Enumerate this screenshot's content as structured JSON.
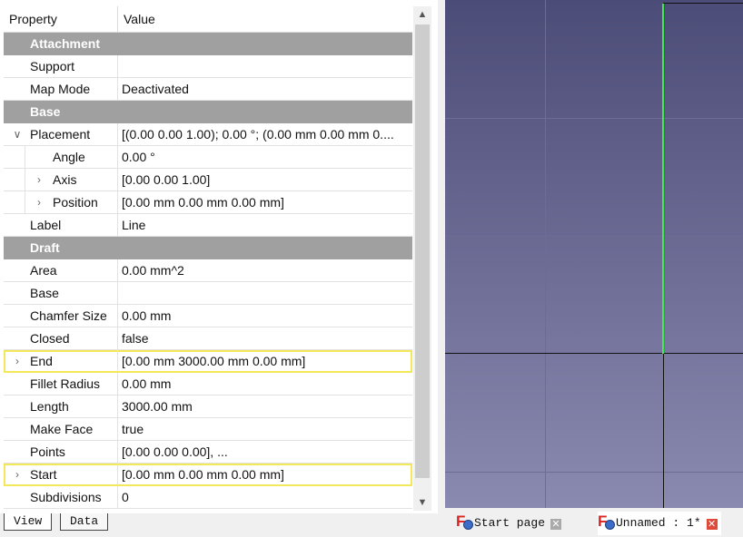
{
  "header": {
    "property": "Property",
    "value": "Value"
  },
  "rows": [
    {
      "kind": "group",
      "name": "Attachment"
    },
    {
      "kind": "prop",
      "name": "Support",
      "value": ""
    },
    {
      "kind": "prop",
      "name": "Map Mode",
      "value": "Deactivated"
    },
    {
      "kind": "group",
      "name": "Base"
    },
    {
      "kind": "prop",
      "name": "Placement",
      "value": "[(0.00 0.00 1.00); 0.00 °; (0.00 mm  0.00 mm  0....",
      "expander": "expanded"
    },
    {
      "kind": "child",
      "name": "Angle",
      "value": "0.00 °"
    },
    {
      "kind": "child",
      "name": "Axis",
      "value": "[0.00 0.00 1.00]",
      "expander": "collapsed"
    },
    {
      "kind": "child",
      "name": "Position",
      "value": "[0.00 mm  0.00 mm  0.00 mm]",
      "expander": "collapsed"
    },
    {
      "kind": "prop",
      "name": "Label",
      "value": "Line"
    },
    {
      "kind": "group",
      "name": "Draft"
    },
    {
      "kind": "prop",
      "name": "Area",
      "value": "0.00 mm^2"
    },
    {
      "kind": "prop",
      "name": "Base",
      "value": ""
    },
    {
      "kind": "prop",
      "name": "Chamfer Size",
      "value": "0.00 mm"
    },
    {
      "kind": "prop",
      "name": "Closed",
      "value": "false"
    },
    {
      "kind": "prop",
      "name": "End",
      "value": "[0.00 mm  3000.00 mm  0.00 mm]",
      "expander": "collapsed",
      "highlighted": true
    },
    {
      "kind": "prop",
      "name": "Fillet Radius",
      "value": "0.00 mm"
    },
    {
      "kind": "prop",
      "name": "Length",
      "value": "3000.00 mm"
    },
    {
      "kind": "prop",
      "name": "Make Face",
      "value": "true"
    },
    {
      "kind": "prop",
      "name": "Points",
      "value": "[0.00 0.00 0.00], ..."
    },
    {
      "kind": "prop",
      "name": "Start",
      "value": "[0.00 mm  0.00 mm  0.00 mm]",
      "expander": "collapsed",
      "highlighted": true
    },
    {
      "kind": "prop",
      "name": "Subdivisions",
      "value": "0"
    }
  ],
  "panel_tabs": {
    "view": "View",
    "data": "Data"
  },
  "doc_tabs": {
    "start": "Start page",
    "unnamed": "Unnamed : 1*"
  },
  "colors": {
    "group_header": "#a0a0a0",
    "highlight": "#f2e85a",
    "line": "#43e84a"
  }
}
